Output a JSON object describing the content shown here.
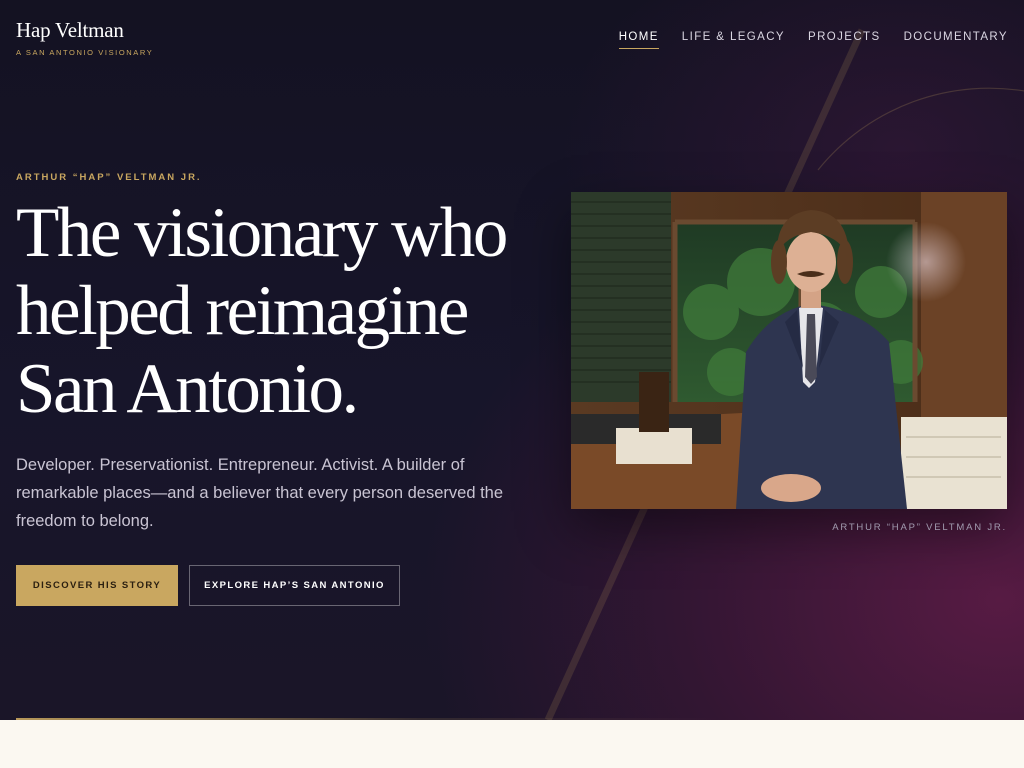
{
  "brand": {
    "name": "Hap Veltman",
    "tagline": "A SAN ANTONIO VISIONARY"
  },
  "nav": {
    "items": [
      {
        "label": "HOME",
        "active": true
      },
      {
        "label": "LIFE & LEGACY",
        "active": false
      },
      {
        "label": "PROJECTS",
        "active": false
      },
      {
        "label": "DOCUMENTARY",
        "active": false
      }
    ]
  },
  "hero": {
    "eyebrow": "ARTHUR “HAP” VELTMAN JR.",
    "headline_lines": [
      "The visionary who",
      "helped reimagine",
      "San Antonio."
    ],
    "intro": "Developer. Preservationist. Entrepreneur. Activist. A builder of remarkable places—and a believer that every person deserved the freedom to belong.",
    "buttons": {
      "primary": "DISCOVER HIS STORY",
      "secondary": "EXPLORE HAP’S SAN ANTONIO"
    },
    "photo_caption": "ARTHUR “HAP” VELTMAN JR."
  },
  "colors": {
    "accent_gold": "#c9a760",
    "hero_dark": "#151323",
    "hero_plum": "#3d1636",
    "page_cream": "#fbf8f1"
  }
}
